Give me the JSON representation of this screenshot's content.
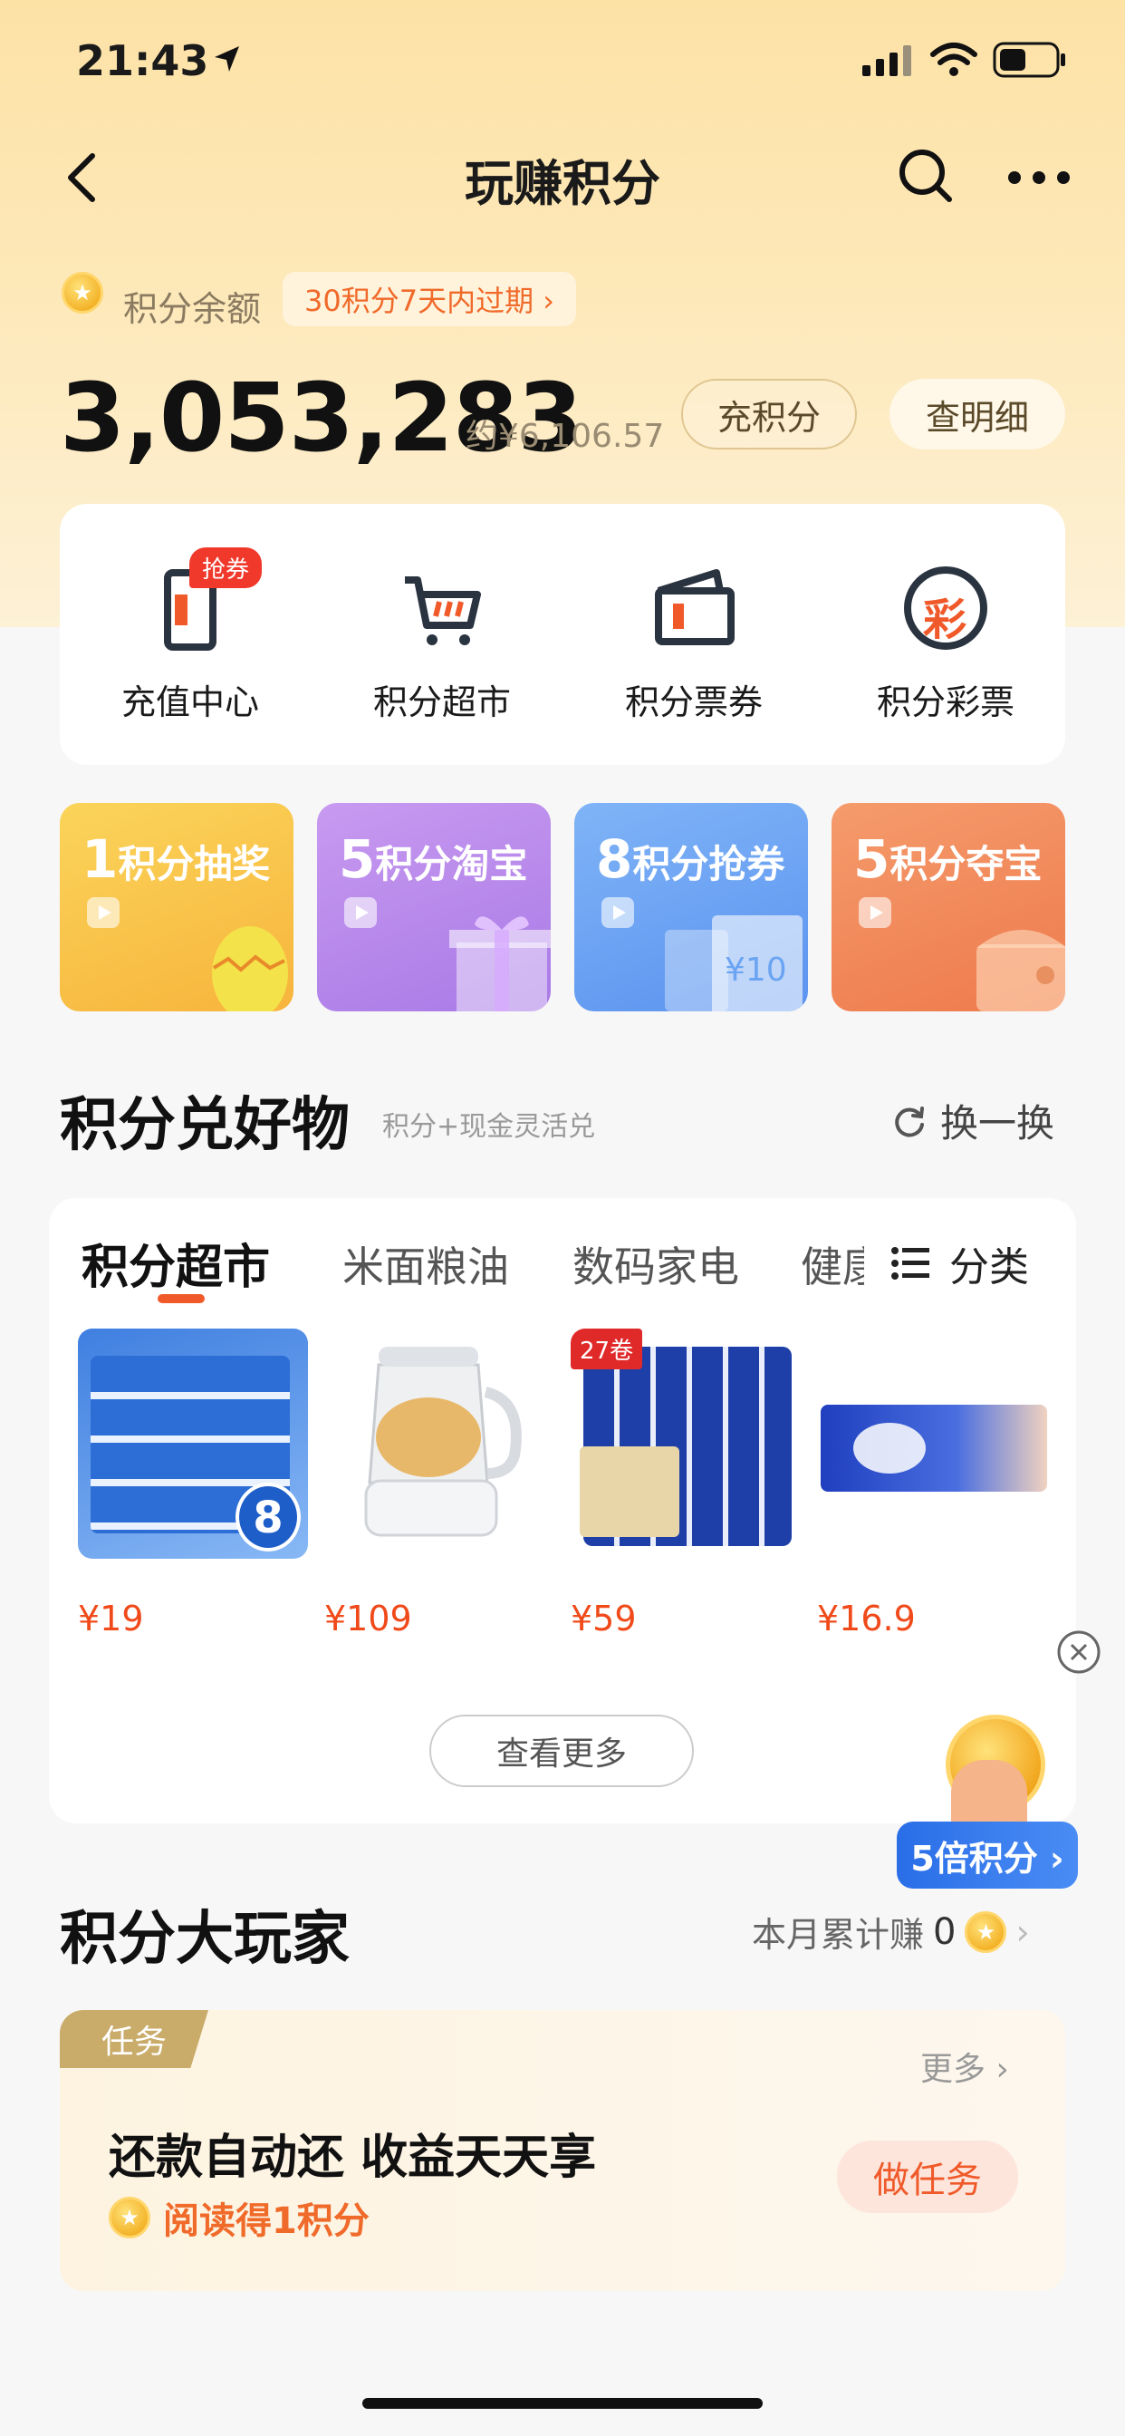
{
  "status_bar": {
    "time": "21:43"
  },
  "nav": {
    "title": "玩赚积分"
  },
  "balance": {
    "label": "积分余额",
    "expire_notice": "30积分7天内过期 ›",
    "amount": "3,053,283",
    "cny_equiv": "约¥6,106.57",
    "recharge_label": "充积分",
    "detail_label": "查明细"
  },
  "quick_actions": [
    {
      "label": "充值中心",
      "icon": "phone-recharge-icon",
      "badge": "抢券"
    },
    {
      "label": "积分超市",
      "icon": "shopping-cart-icon"
    },
    {
      "label": "积分票券",
      "icon": "wallet-ticket-icon"
    },
    {
      "label": "积分彩票",
      "icon": "lottery-icon",
      "glyph": "彩"
    }
  ],
  "promos": [
    {
      "num": "1",
      "label": "积分抽奖",
      "color_from": "#fbd45a",
      "color_to": "#f7b43c"
    },
    {
      "num": "5",
      "label": "积分淘宝",
      "color_from": "#c89af0",
      "color_to": "#a97ae6"
    },
    {
      "num": "8",
      "label": "积分抢券",
      "color_from": "#7fb4f7",
      "color_to": "#5b93ef"
    },
    {
      "num": "5",
      "label": "积分夺宝",
      "color_from": "#f59b6c",
      "color_to": "#ee7a4c"
    }
  ],
  "goods_section": {
    "title": "积分兑好物",
    "subtitle": "积分+现金灵活兑",
    "refresh_label": "换一换",
    "tabs": [
      "积分超市",
      "米面粮油",
      "数码家电",
      "健康"
    ],
    "category_label": "分类",
    "products": [
      {
        "price": "¥19",
        "name": "tissue-pack"
      },
      {
        "price": "¥109",
        "name": "health-kettle"
      },
      {
        "price": "¥59",
        "name": "toilet-paper-rolls",
        "tag": "27卷"
      },
      {
        "price": "¥16.9",
        "name": "tissue-bag"
      }
    ],
    "see_more_label": "查看更多"
  },
  "floating_badge": {
    "label": "5倍积分 ›"
  },
  "player_section": {
    "title": "积分大玩家",
    "monthly_label": "本月累计赚",
    "monthly_value": "0"
  },
  "task": {
    "tag": "任务",
    "more_label": "更多 ›",
    "title": "还款自动还 收益天天享",
    "reward": "阅读得1积分",
    "button_label": "做任务"
  },
  "colors": {
    "accent": "#f05a2a",
    "price": "#f04a1a",
    "header_bg": "#fde2a6"
  }
}
